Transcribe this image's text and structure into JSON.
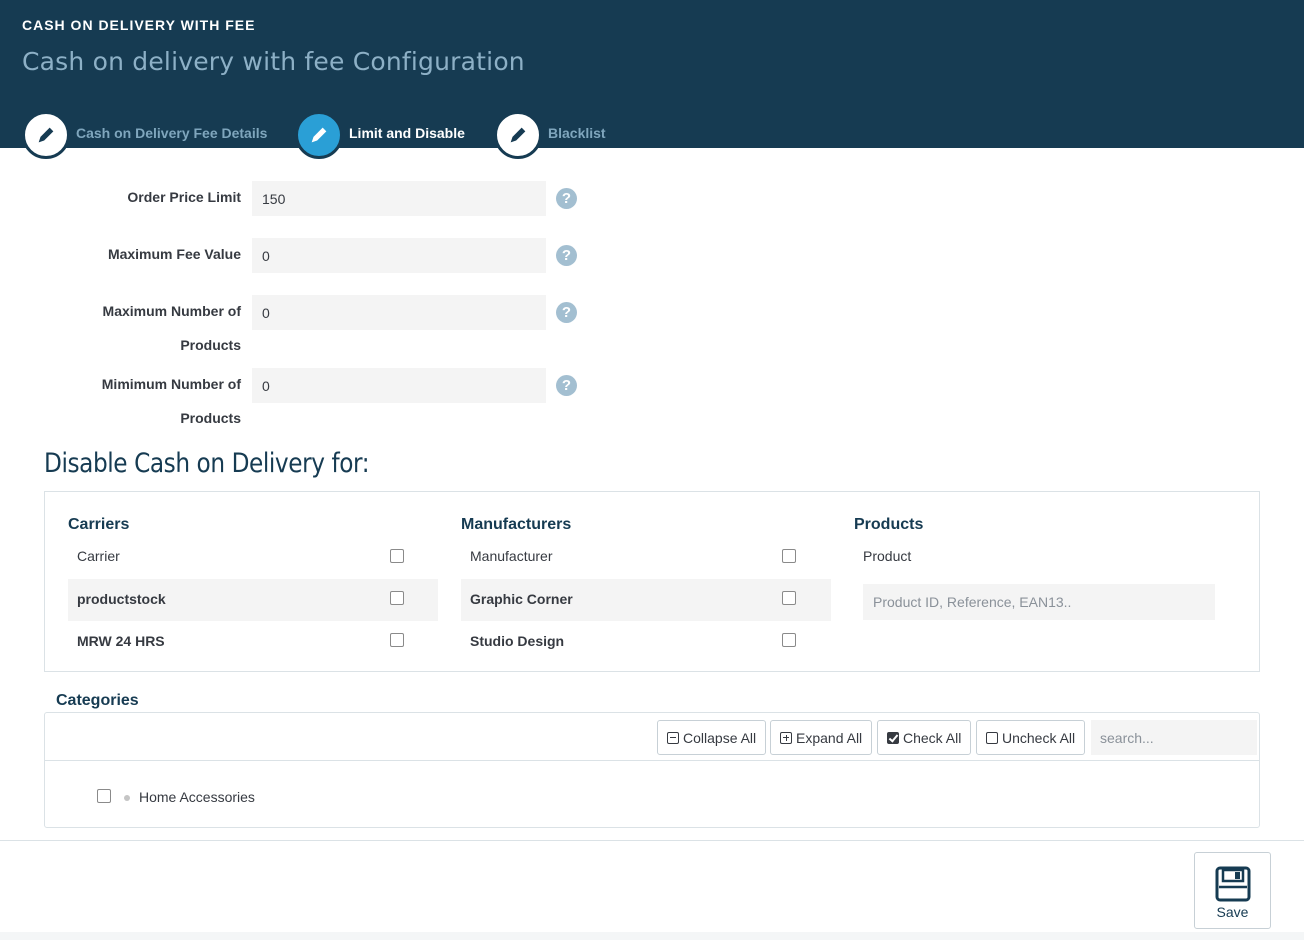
{
  "header": {
    "module_name": "CASH ON DELIVERY WITH FEE",
    "title": "Cash on delivery with fee Configuration"
  },
  "steps": [
    {
      "label": "Cash on Delivery Fee Details",
      "active": false
    },
    {
      "label": "Limit and Disable",
      "active": true
    },
    {
      "label": "Blacklist",
      "active": false
    }
  ],
  "form": {
    "order_price_limit": {
      "label": "Order Price Limit",
      "value": "150"
    },
    "maximum_fee_value": {
      "label": "Maximum Fee Value",
      "value": "0"
    },
    "maximum_number_of_products": {
      "label_line1": "Maximum Number of",
      "label_line2": "Products",
      "value": "0"
    },
    "minimum_number_of_products": {
      "label_line1": "Mimimum Number of",
      "label_line2": "Products",
      "value": "0"
    },
    "help_glyph": "?"
  },
  "disable_section": {
    "title": "Disable Cash on Delivery for:",
    "carriers": {
      "title": "Carriers",
      "header": "Carrier",
      "items": [
        "productstock",
        "MRW 24 HRS"
      ]
    },
    "manufacturers": {
      "title": "Manufacturers",
      "header": "Manufacturer",
      "items": [
        "Graphic Corner",
        "Studio Design"
      ]
    },
    "products": {
      "title": "Products",
      "header": "Product",
      "search_placeholder": "Product ID, Reference, EAN13.."
    }
  },
  "categories": {
    "title": "Categories",
    "toolbar": {
      "collapse_all": "Collapse All",
      "expand_all": "Expand All",
      "check_all": "Check All",
      "uncheck_all": "Uncheck All",
      "search_placeholder": "search..."
    },
    "items": [
      "Home Accessories"
    ]
  },
  "footer": {
    "save_label": "Save"
  },
  "colors": {
    "header_bg": "#163b52",
    "accent": "#2a9fd6",
    "help_icon": "#a3bfd1"
  }
}
